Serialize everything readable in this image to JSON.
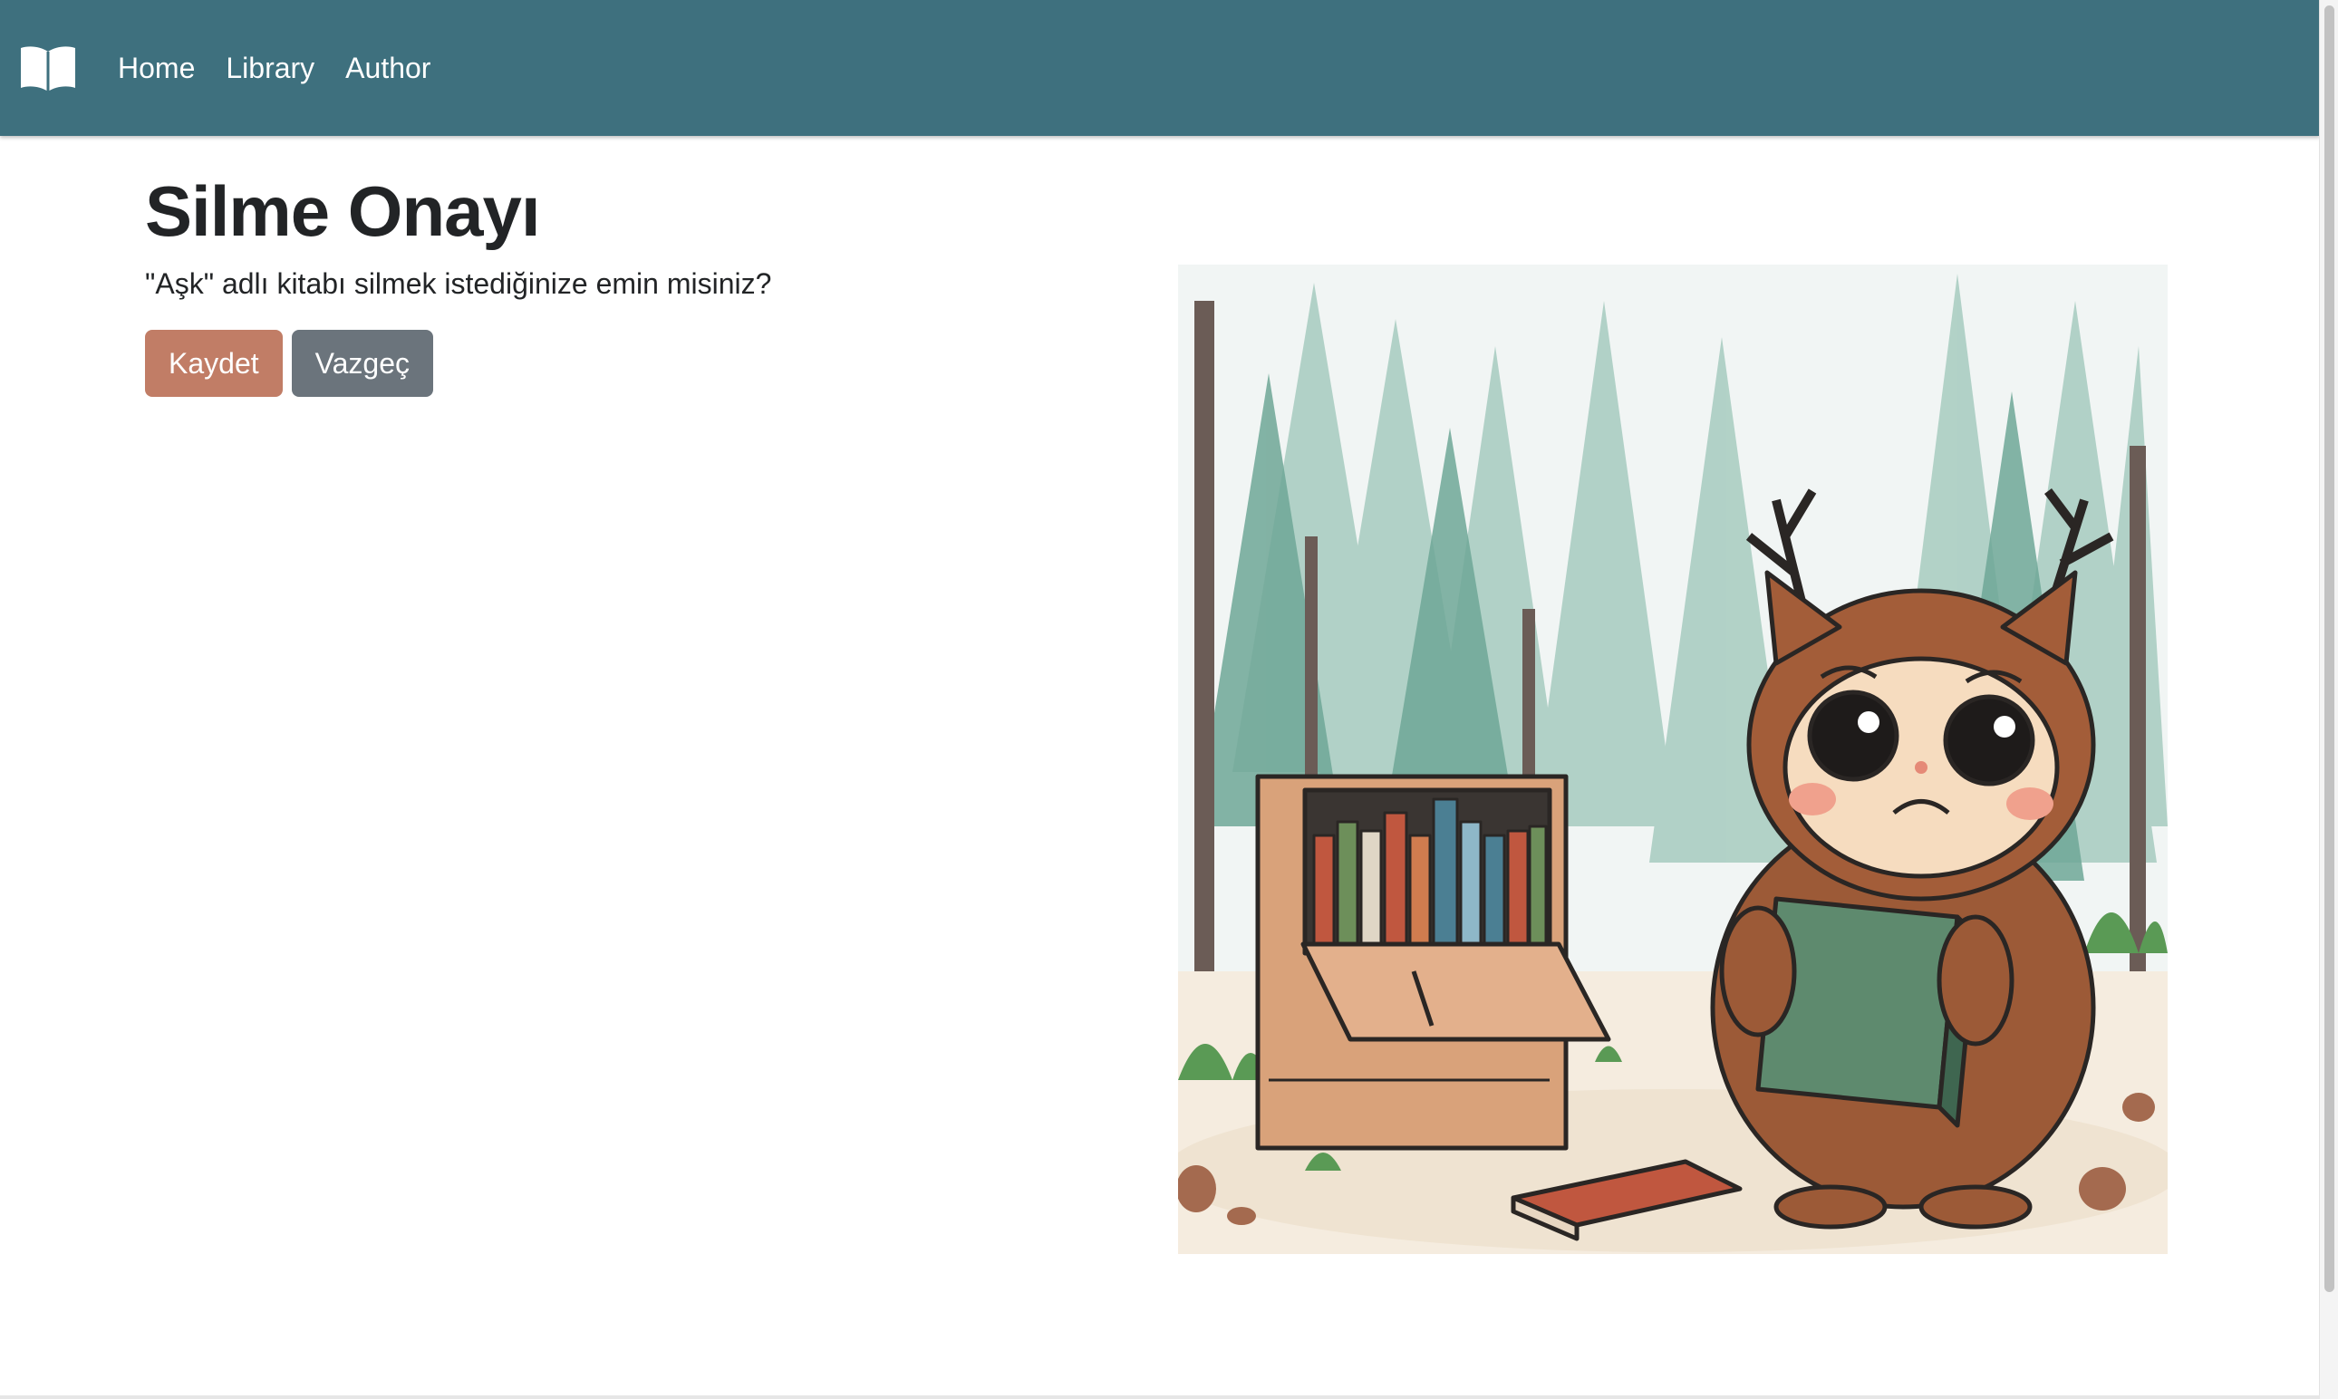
{
  "navbar": {
    "brand_icon": "open-book-icon",
    "links": [
      {
        "label": "Home"
      },
      {
        "label": "Library"
      },
      {
        "label": "Author"
      }
    ],
    "background_color": "#3e707e"
  },
  "page": {
    "title": "Silme Onayı",
    "confirm_text": "\"Aşk\" adlı kitabı silmek istediğinize emin misiniz?"
  },
  "actions": {
    "save_label": "Kaydet",
    "cancel_label": "Vazgeç",
    "save_color": "#c17d66",
    "cancel_color": "#6b747c"
  },
  "illustration": {
    "icon": "sad-owl-with-book-icon"
  }
}
